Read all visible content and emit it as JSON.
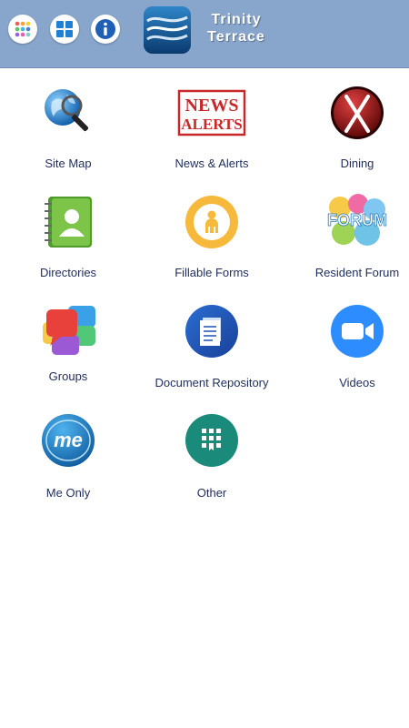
{
  "header": {
    "title_line1": "Trinity",
    "title_line2": "Terrace",
    "buttons": [
      "apps-grid-icon",
      "windows-icon",
      "info-icon"
    ]
  },
  "tiles": [
    {
      "label": "Site Map",
      "icon": "globe-magnifier-icon"
    },
    {
      "label": "News & Alerts",
      "icon": "news-alerts-stamp-icon"
    },
    {
      "label": "Dining",
      "icon": "fork-knife-icon"
    },
    {
      "label": "Directories",
      "icon": "address-book-icon"
    },
    {
      "label": "Fillable Forms",
      "icon": "person-form-icon"
    },
    {
      "label": "Resident Forum",
      "icon": "forum-bubbles-icon"
    },
    {
      "label": "Groups",
      "icon": "chat-bubbles-icon"
    },
    {
      "label": "Document Repository",
      "icon": "document-icon"
    },
    {
      "label": "Videos",
      "icon": "video-camera-icon"
    },
    {
      "label": "Me Only",
      "icon": "me-bubble-icon"
    },
    {
      "label": "Other",
      "icon": "grid-folder-icon"
    }
  ],
  "icon_text": {
    "news_line1": "NEWS",
    "news_line2": "ALERTS",
    "forum": "FORUM",
    "me": "me"
  },
  "colors": {
    "header_bg": "#88a6cc",
    "label_text": "#1f2d5c"
  }
}
